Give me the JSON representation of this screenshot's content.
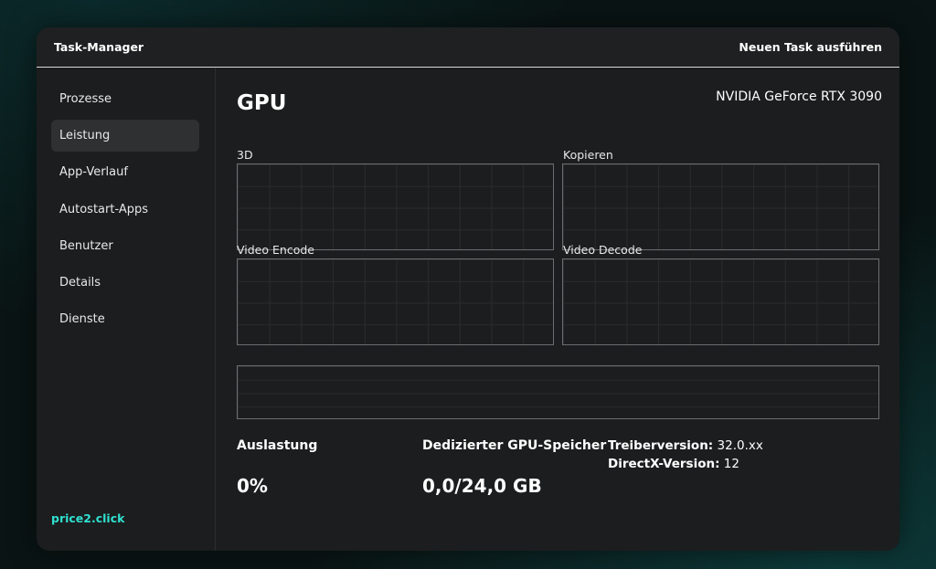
{
  "window": {
    "title": "Task-Manager",
    "run_task": "Neuen Task ausführen"
  },
  "sidebar": {
    "items": [
      {
        "label": "Prozesse"
      },
      {
        "label": "Leistung",
        "active": true
      },
      {
        "label": "App-Verlauf"
      },
      {
        "label": "Autostart-Apps"
      },
      {
        "label": "Benutzer"
      },
      {
        "label": "Details"
      },
      {
        "label": "Dienste"
      }
    ],
    "brand": "price2.click"
  },
  "main": {
    "title": "GPU",
    "model": "NVIDIA GeForce RTX 3090",
    "graphs": [
      {
        "label": "3D"
      },
      {
        "label": "Kopieren"
      },
      {
        "label": "Video Encode"
      },
      {
        "label": "Video Decode"
      }
    ],
    "stats": {
      "utilization_label": "Auslastung",
      "utilization_value": "0%",
      "memory_label": "Dedizierter GPU-Speicher",
      "memory_value": "0,0/24,0 GB",
      "driver_key": "Treiberversion:",
      "driver_value": " 32.0.xx",
      "directx_key": "DirectX-Version:",
      "directx_value": " 12"
    }
  },
  "colors": {
    "accent": "#2fe0d0",
    "window_bg": "#1c1d1e",
    "active_item": "#2f3031",
    "graph_border": "#6b6e70"
  }
}
